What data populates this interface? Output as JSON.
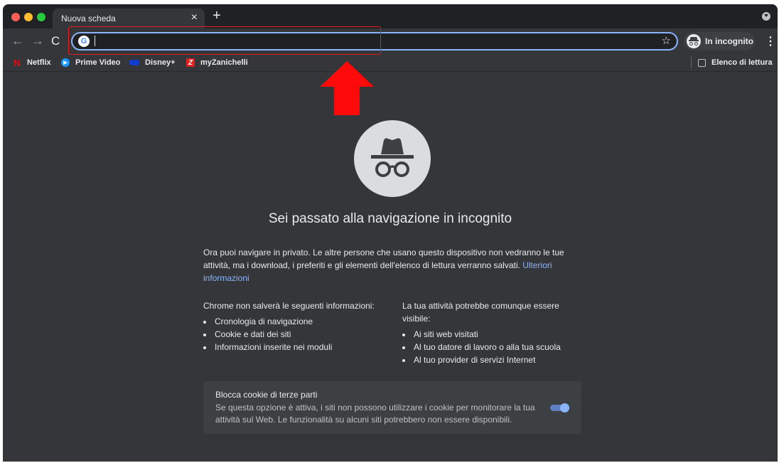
{
  "tab": {
    "title": "Nuova scheda",
    "close_icon": "close-icon",
    "new_tab_symbol": "+"
  },
  "toolbar": {
    "back_symbol": "←",
    "forward_symbol": "→",
    "reload_symbol": "C",
    "omnibox_value": "",
    "google_letter": "G",
    "star_symbol": "☆",
    "incognito_label": "In incognito",
    "menu_symbol": "⋮"
  },
  "bookmarks": [
    {
      "label": "Netflix",
      "icon": "netflix-icon"
    },
    {
      "label": "Prime Video",
      "icon": "prime-video-icon"
    },
    {
      "label": "Disney+",
      "icon": "disney-plus-icon"
    },
    {
      "label": "myZanichelli",
      "icon": "zanichelli-icon"
    }
  ],
  "reading_list": {
    "label": "Elenco di lettura"
  },
  "content": {
    "headline": "Sei passato alla navigazione in incognito",
    "intro": "Ora puoi navigare in privato. Le altre persone che usano questo dispositivo non vedranno le tue attività, ma i download, i preferiti e gli elementi dell'elenco di lettura verranno salvati.",
    "learn_more": "Ulteriori informazioni",
    "left_column": {
      "heading": "Chrome non salverà le seguenti informazioni:",
      "items": [
        "Cronologia di navigazione",
        "Cookie e dati dei siti",
        "Informazioni inserite nei moduli"
      ]
    },
    "right_column": {
      "heading": "La tua attività potrebbe comunque essere visibile:",
      "items": [
        "Ai siti web visitati",
        "Al tuo datore di lavoro o alla tua scuola",
        "Al tuo provider di servizi Internet"
      ]
    },
    "cookie_card": {
      "title": "Blocca cookie di terze parti",
      "description": "Se questa opzione è attiva, i siti non possono utilizzare i cookie per monitorare la tua attività sul Web. Le funzionalità su alcuni siti potrebbero non essere disponibili.",
      "toggle_on": true
    }
  },
  "colors": {
    "tabstrip": "#202124",
    "surface": "#35363a",
    "accent": "#8ab4f8",
    "annotation_red": "#e02020"
  }
}
